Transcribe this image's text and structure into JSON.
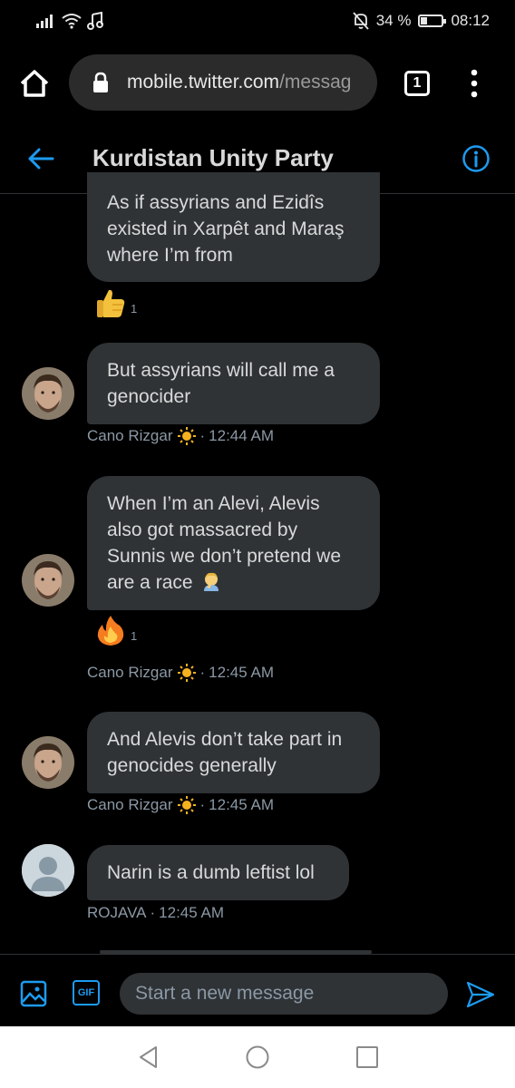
{
  "status_bar": {
    "battery_text": "34 %",
    "battery_fraction": 0.34,
    "time": "08:12"
  },
  "browser": {
    "url_host": "mobile.twitter.com",
    "url_path": "/messag",
    "tab_count": "1"
  },
  "header": {
    "title": "Kurdistan Unity Party"
  },
  "messages": [
    {
      "lines": [
        "As if assyrians and Ezidîs",
        "existed in Xarpêt and Maraş",
        "where I’m from"
      ],
      "reaction_count": "1",
      "reaction_icon": "thumbs-up-icon"
    },
    {
      "lines": [
        "But assyrians will call me a",
        "genocider"
      ],
      "author": "Cano Rizgar",
      "time": "12:44 AM"
    },
    {
      "lines": [
        "When I’m an Alevi, Alevis",
        "also got massacred by",
        "Sunnis we don’t pretend we",
        "are a race"
      ],
      "reaction_count": "1",
      "reaction_icon": "fire-icon",
      "author": "Cano Rizgar",
      "time": "12:45 AM"
    },
    {
      "lines": [
        "And Alevis don’t take part in",
        "genocides generally"
      ],
      "author": "Cano Rizgar",
      "time": "12:45 AM"
    },
    {
      "lines": [
        "Narin is a dumb leftist lol"
      ],
      "author": "ROJAVA",
      "time": "12:45 AM"
    }
  ],
  "composer": {
    "placeholder": "Start a new message",
    "gif_label": "GIF"
  },
  "separator": "·",
  "colors": {
    "accent": "#1d9bf0",
    "bubble": "#2f3336",
    "meta": "#8b98a5",
    "background": "#000000"
  }
}
